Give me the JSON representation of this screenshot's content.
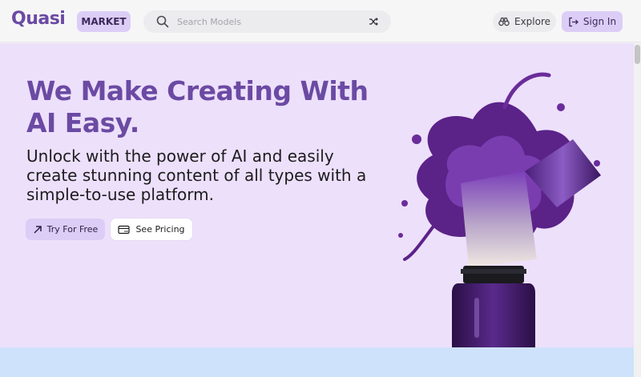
{
  "header": {
    "logo": "Quasi",
    "market_label": "MARKET",
    "search": {
      "placeholder": "Search Models",
      "value": ""
    },
    "explore_label": "Explore",
    "signin_label": "Sign In"
  },
  "hero": {
    "headline": "We Make Creating With AI Easy.",
    "subhead": "Unlock with the power of AI and easily create stunning content of all types with a simple-to-use platform.",
    "try_label": "Try For Free",
    "pricing_label": "See Pricing"
  },
  "icons": {
    "search": "search-icon",
    "shuffle": "shuffle-icon",
    "explore": "binoculars-icon",
    "signin": "login-arrow-icon",
    "try": "arrow-up-right-icon",
    "pricing": "price-tag-icon"
  },
  "colors": {
    "brand": "#6b4aa3",
    "accent_bg": "#dccdf7",
    "hero_bg": "#ede0fb",
    "band": "#cfe2fb"
  }
}
